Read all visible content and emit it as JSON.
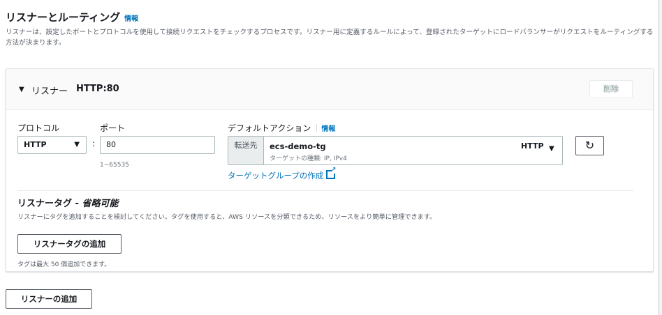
{
  "section": {
    "title": "リスナーとルーティング",
    "info_link": "情報",
    "description": "リスナーは、設定したポートとプロトコルを使用して接続リクエストをチェックするプロセスです。リスナー用に定義するルールによって、登録されたターゲットにロードバランサーがリクエストをルーティングする方法が決まります。"
  },
  "listener": {
    "prefix": "リスナー",
    "name": "HTTP:80",
    "delete_label": "削除",
    "protocol_label": "プロトコル",
    "protocol_value": "HTTP",
    "port_label": "ポート",
    "port_value": "80",
    "port_hint": "1~65535",
    "default_action_label": "デフォルトアクション",
    "default_action_info": "情報",
    "forward_addon": "転送先",
    "target_group_name": "ecs-demo-tg",
    "target_group_protocol": "HTTP",
    "target_group_sub": "ターゲットの種類: IP, IPv4",
    "create_target_group_link": "ターゲットグループの作成",
    "tags": {
      "heading": "リスナータグ - ",
      "heading_optional": "省略可能",
      "description": "リスナーにタグを追加することを検討してください。タグを使用すると、AWS リソースを分類できるため、リソースをより簡単に管理できます。",
      "add_button": "リスナータグの追加",
      "limit_text": "タグは最大 50 個追加できます。"
    }
  },
  "add_listener_button": "リスナーの追加",
  "icons": {
    "caret": "caret-down-icon",
    "dropdown": "dropdown-triangle-icon",
    "refresh": "refresh-icon",
    "external": "external-link-icon"
  },
  "colors": {
    "link": "#0073bb",
    "text": "#16191f",
    "muted": "#545b64",
    "disabled": "#aab7b8"
  }
}
